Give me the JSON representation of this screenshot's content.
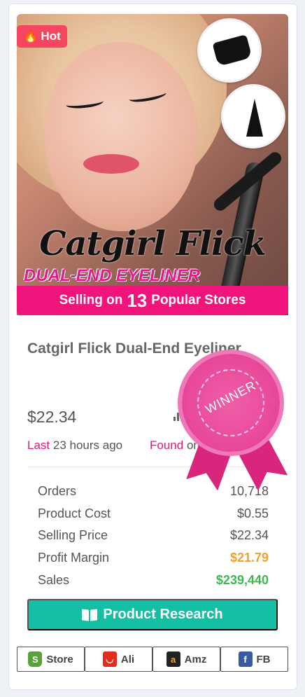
{
  "badge": {
    "label": "Hot"
  },
  "hero": {
    "promo_title": "Catgirl Flick",
    "promo_subtitle": "DUAL-END EYELINER"
  },
  "selling_banner": {
    "prefix": "Selling on",
    "count": "13",
    "suffix": "Popular Stores"
  },
  "product": {
    "name": "Catgirl Flick Dual-End Eyeliner",
    "price": "$22.34",
    "meta_right": "d",
    "last_label": "Last",
    "last_value": "23 hours ago",
    "found_label": "Found",
    "found_value": "on"
  },
  "stats": [
    {
      "label": "Orders",
      "value": "10,718",
      "tone": "normal"
    },
    {
      "label": "Product Cost",
      "value": "$0.55",
      "tone": "normal"
    },
    {
      "label": "Selling Price",
      "value": "$22.34",
      "tone": "normal"
    },
    {
      "label": "Profit Margin",
      "value": "$21.79",
      "tone": "orange"
    },
    {
      "label": "Sales",
      "value": "$239,440",
      "tone": "green"
    }
  ],
  "actions": {
    "research_label": "Product Research"
  },
  "links": [
    {
      "label": "Store",
      "icon": "shopify-icon"
    },
    {
      "label": "Ali",
      "icon": "aliexpress-icon"
    },
    {
      "label": "Amz",
      "icon": "amazon-icon"
    },
    {
      "label": "FB",
      "icon": "facebook-icon"
    }
  ],
  "winner_ribbon": {
    "label": "WINNER"
  },
  "colors": {
    "accent_pink": "#f0147c",
    "hot_badge": "#f5455f",
    "research_teal": "#14c0a4",
    "profit_orange": "#f4a02e",
    "sales_green": "#3fb852"
  }
}
